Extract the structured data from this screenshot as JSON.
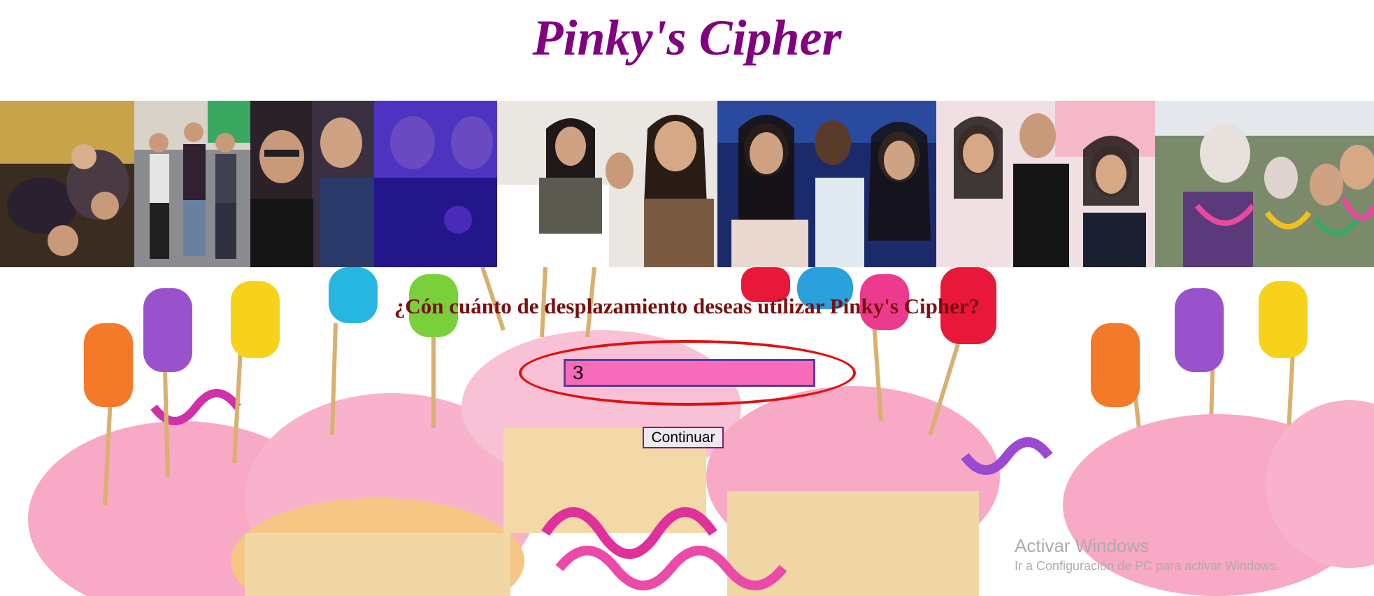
{
  "page": {
    "title": "Pinky's Cipher",
    "question": "¿Cón cuánto de desplazamiento deseas utilizar Pinky's Cipher?",
    "shift_value": "3",
    "continue_label": "Continuar"
  },
  "colors": {
    "title": "#800080",
    "question": "#7a0f0f",
    "input_bg": "#f76bb8",
    "button_bg": "#f0e8f0",
    "highlight": "#e01010"
  },
  "photos": [
    {
      "alt": "group photo 1"
    },
    {
      "alt": "group photo 2"
    },
    {
      "alt": "group photo 3"
    },
    {
      "alt": "group photo 4"
    },
    {
      "alt": "group photo 5"
    },
    {
      "alt": "group photo 6"
    },
    {
      "alt": "group photo 7"
    },
    {
      "alt": "group photo 8"
    }
  ],
  "os_watermark": {
    "title": "Activar Windows",
    "subtitle": "Ir a Configuración de PC para activar Windows."
  }
}
